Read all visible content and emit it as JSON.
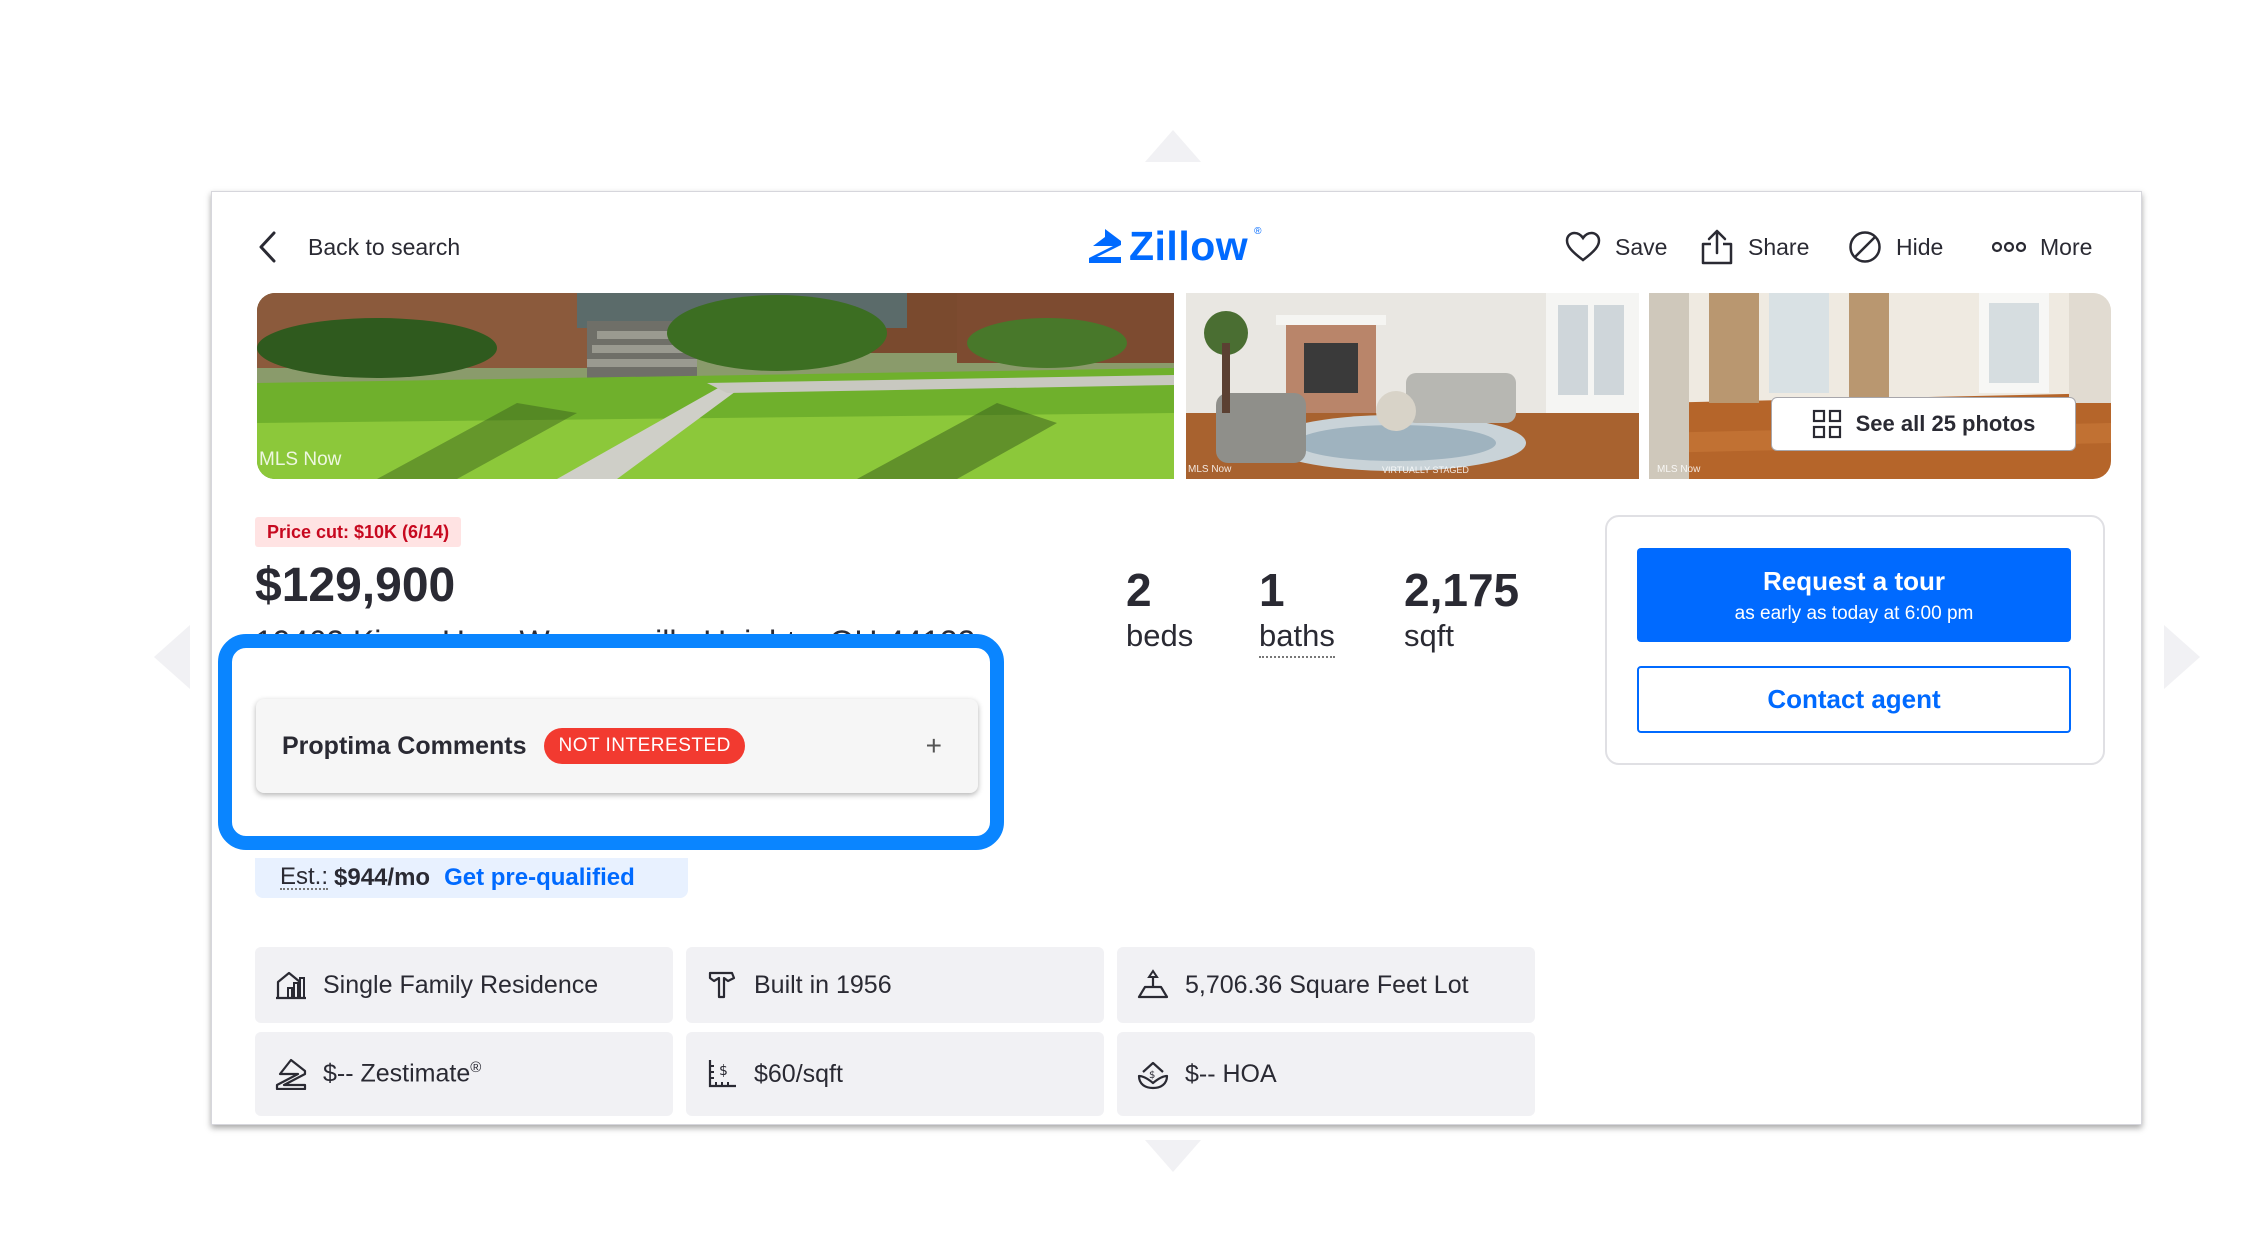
{
  "header": {
    "back_label": "Back to search",
    "logo_text": "Zillow",
    "logo_mark": "®",
    "actions": {
      "save": "Save",
      "share": "Share",
      "hide": "Hide",
      "more": "More"
    }
  },
  "photos": {
    "credits": [
      "MLS Now",
      "MLS Now",
      "VIRTUALLY STAGED",
      "MLS Now"
    ],
    "see_all_label": "See all 25 photos"
  },
  "listing": {
    "price_cut": "Price cut: $10K (6/14)",
    "price": "$129,900",
    "address": "19462 Kings Hwy, Warrensville Heights, OH 44122",
    "stats": [
      {
        "value": "2",
        "label": "beds"
      },
      {
        "value": "1",
        "label": "baths"
      },
      {
        "value": "2,175",
        "label": "sqft"
      }
    ]
  },
  "proptima": {
    "title": "Proptima Comments",
    "status_badge": "NOT INTERESTED",
    "expand_symbol": "+"
  },
  "estimate": {
    "label": "Est.:",
    "value": "$944/mo",
    "link": "Get pre-qualified"
  },
  "facts": {
    "type": "Single Family Residence",
    "built": "Built in 1956",
    "lot": "5,706.36 Square Feet Lot",
    "zestimate": "$-- Zestimate",
    "zestimate_mark": "®",
    "price_per_sqft": "$60/sqft",
    "hoa": "$-- HOA"
  },
  "tour": {
    "request_label": "Request a tour",
    "request_sub": "as early as today at 6:00 pm",
    "contact_label": "Contact agent"
  },
  "colors": {
    "accent": "#006aff",
    "highlight_border": "#0a85ff",
    "badge_red": "#f23a30",
    "price_cut_text": "#c7081f",
    "chip_bg": "#f1f1f4"
  },
  "icons": [
    "chevron-left-icon",
    "zillow-logo-icon",
    "heart-icon",
    "share-icon",
    "hide-icon",
    "more-icon",
    "grid-icon",
    "house-chart-icon",
    "hammer-icon",
    "lot-icon",
    "zestimate-icon",
    "price-per-sqft-icon",
    "hoa-icon"
  ]
}
